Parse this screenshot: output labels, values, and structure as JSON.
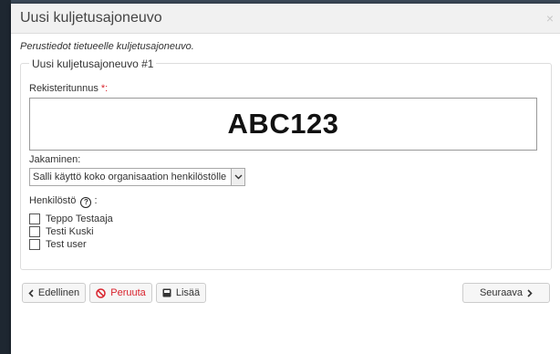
{
  "dialog": {
    "title": "Uusi kuljetusajoneuvo",
    "close_icon": "×",
    "intro": "Perustiedot tietueelle kuljetusajoneuvo.",
    "legend": "Uusi kuljetusajoneuvo #1"
  },
  "form": {
    "registration_label": "Rekisteritunnus",
    "required_mark": "*",
    "label_colon": ":",
    "registration_value": "ABC123",
    "sharing_label": "Jakaminen:",
    "sharing_selected": "Salli käyttö koko organisaation henkilöstölle",
    "staff_label": "Henkilöstö",
    "staff_suffix": ":",
    "staff_members": [
      "Teppo Testaaja",
      "Testi Kuski",
      "Test user"
    ]
  },
  "buttons": {
    "previous": "Edellinen",
    "cancel": "Peruuta",
    "add": "Lisää",
    "next": "Seuraava"
  },
  "colors": {
    "required": "#d9232d",
    "cancel": "#d9232d"
  }
}
